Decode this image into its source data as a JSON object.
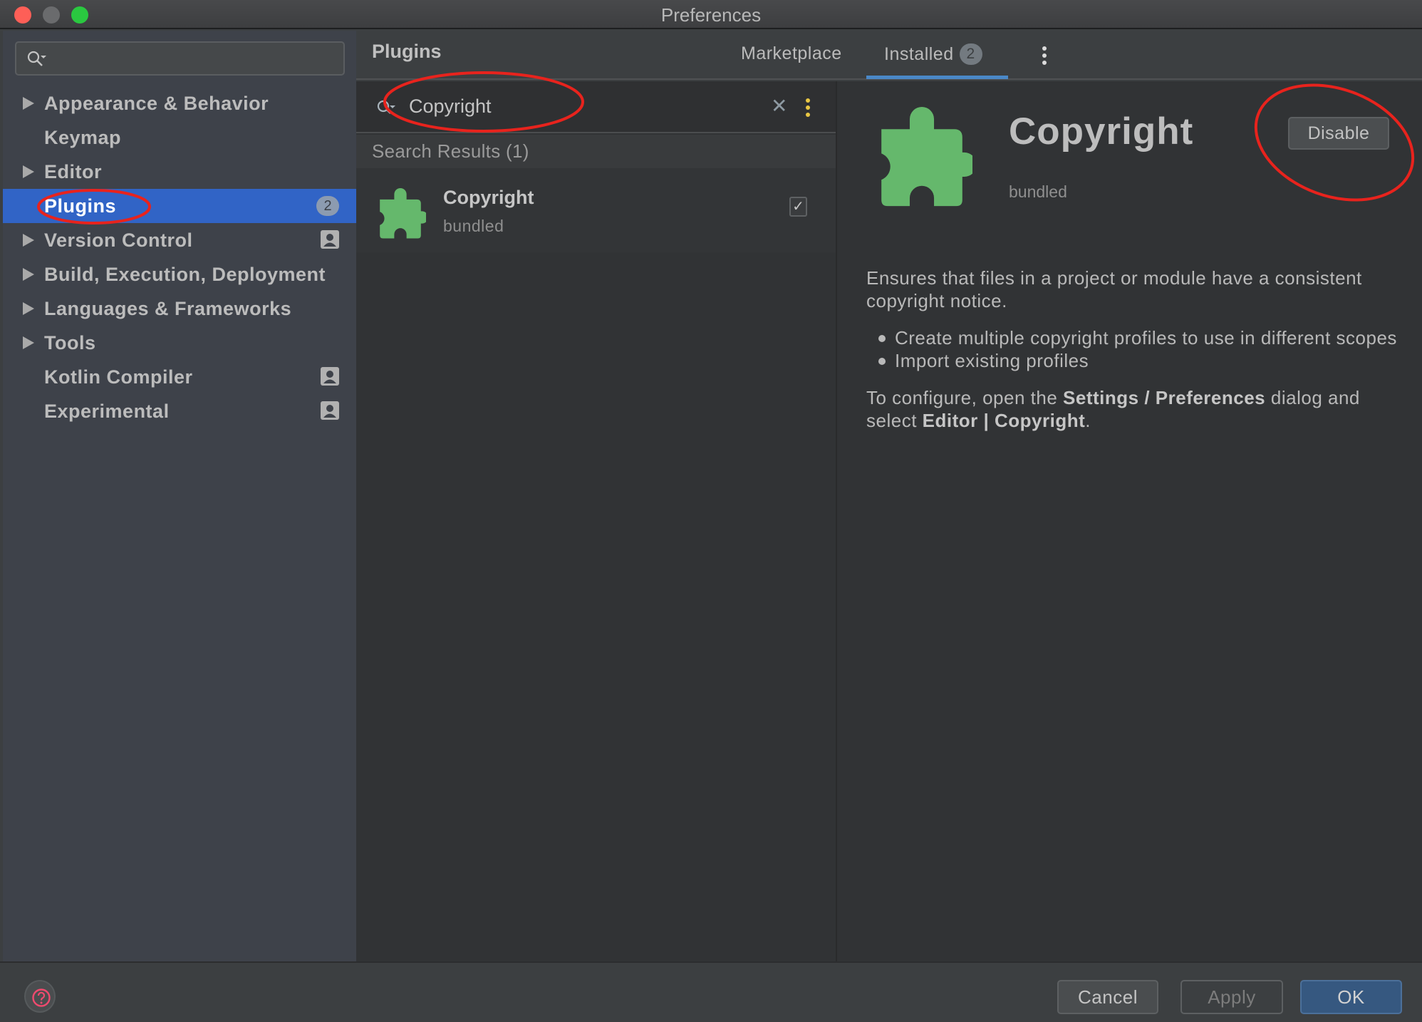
{
  "window": {
    "title": "Preferences"
  },
  "sidebar": {
    "search": {
      "value": "",
      "placeholder": ""
    },
    "items": [
      {
        "label": "Appearance & Behavior",
        "expandable": true
      },
      {
        "label": "Keymap",
        "expandable": false
      },
      {
        "label": "Editor",
        "expandable": true
      },
      {
        "label": "Plugins",
        "expandable": false,
        "selected": true,
        "badge": "2"
      },
      {
        "label": "Version Control",
        "expandable": true,
        "project_icon": true
      },
      {
        "label": "Build, Execution, Deployment",
        "expandable": true
      },
      {
        "label": "Languages & Frameworks",
        "expandable": true
      },
      {
        "label": "Tools",
        "expandable": true
      },
      {
        "label": "Kotlin Compiler",
        "expandable": false,
        "project_icon": true
      },
      {
        "label": "Experimental",
        "expandable": false,
        "project_icon": true
      }
    ]
  },
  "header": {
    "title": "Plugins",
    "tabs": [
      {
        "label": "Marketplace",
        "active": false
      },
      {
        "label": "Installed",
        "active": true,
        "badge": "2"
      }
    ],
    "more_icon": "vertical-ellipsis-icon"
  },
  "plugin_search": {
    "value": "Copyright",
    "clear_icon": "close-icon",
    "options_icon": "vertical-ellipsis-icon",
    "results_header": "Search Results (1)"
  },
  "results": [
    {
      "name": "Copyright",
      "subtitle": "bundled",
      "enabled": true,
      "icon": "puzzle-piece-icon"
    }
  ],
  "detail": {
    "name": "Copyright",
    "subtitle": "bundled",
    "disable_label": "Disable",
    "description": "Ensures that files in a project or module have a consistent copyright notice.",
    "bullets": [
      "Create multiple copyright profiles to use in different scopes",
      "Import existing profiles"
    ],
    "configure": {
      "prefix": "To configure, open the ",
      "bold1": "Settings / Preferences",
      "middle": " dialog and select ",
      "bold2": "Editor | Copyright",
      "suffix": "."
    }
  },
  "footer": {
    "help_icon": "help-icon",
    "cancel_label": "Cancel",
    "apply_label": "Apply",
    "ok_label": "OK"
  },
  "colors": {
    "selection": "#3164c6",
    "tab_underline": "#4a88c7",
    "plugin_icon": "#65b86c",
    "ok_button": "#365880",
    "annotation": "#e8231d",
    "options_dots": "#e9c744"
  }
}
